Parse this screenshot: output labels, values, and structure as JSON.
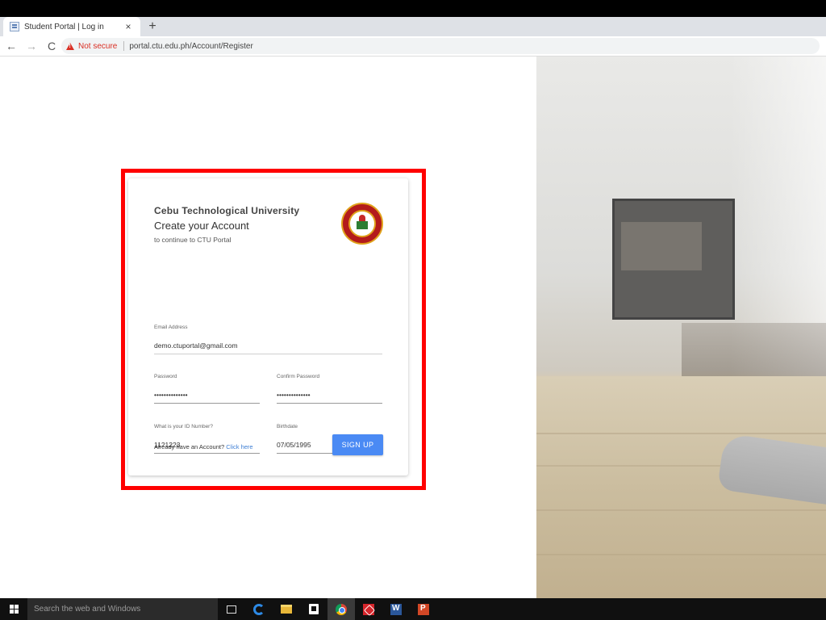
{
  "browser": {
    "tab_title": "Student Portal | Log in",
    "tab_close": "×",
    "new_tab": "+",
    "back": "←",
    "forward": "→",
    "reload": "C",
    "security_text": "Not secure",
    "url": "portal.ctu.edu.ph/Account/Register"
  },
  "card": {
    "university": "Cebu Technological University",
    "heading": "Create your Account",
    "subtitle": "to continue to CTU Portal",
    "fields": {
      "email": {
        "label": "Email Address",
        "value": "demo.ctuportal@gmail.com"
      },
      "password": {
        "label": "Password",
        "value": "••••••••••••••"
      },
      "confirm_password": {
        "label": "Confirm Password",
        "value": "••••••••••••••"
      },
      "id_number": {
        "label": "What is your ID Number?",
        "value": "1121223"
      },
      "birthdate": {
        "label": "Birthdate",
        "value": "07/05/1995"
      }
    },
    "footer_prompt": "Already have an Account?",
    "footer_link": "Click here",
    "signup_label": "SIGN UP"
  },
  "taskbar": {
    "search_placeholder": "Search the web and Windows",
    "apps": [
      "task-view",
      "edge",
      "file-explorer",
      "store",
      "chrome",
      "acrobat",
      "word",
      "powerpoint"
    ]
  },
  "colors": {
    "highlight": "#ff0000",
    "signup_button": "#4a8af4",
    "link": "#3f7fd4",
    "not_secure": "#d93025"
  }
}
